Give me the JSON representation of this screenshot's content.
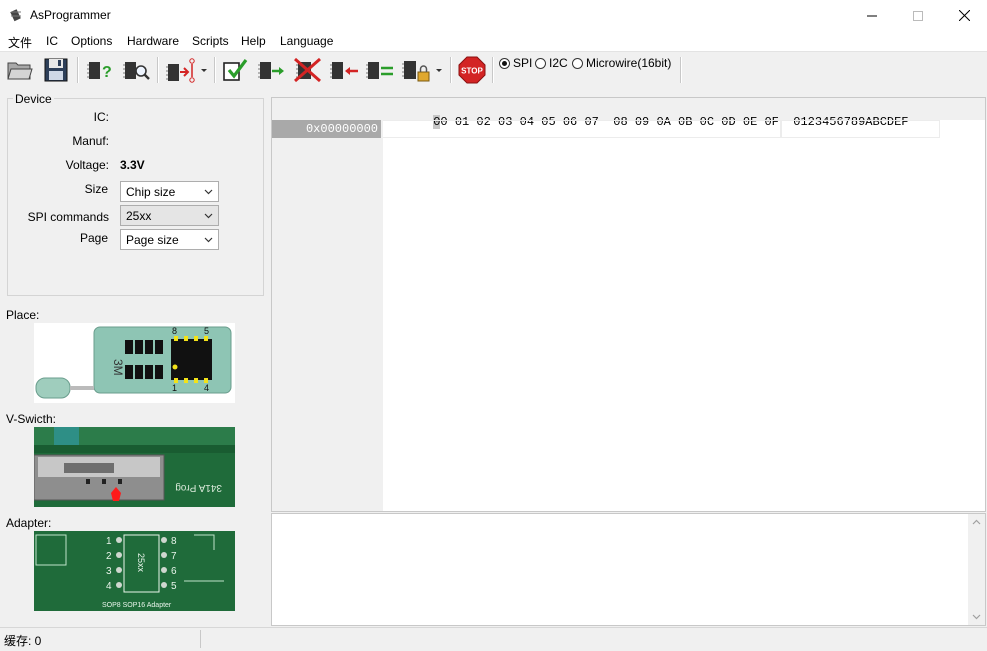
{
  "window": {
    "title": "AsProgrammer"
  },
  "menu": [
    "文件",
    "IC",
    "Options",
    "Hardware",
    "Scripts",
    "Help",
    "Language"
  ],
  "toolbar": {
    "buttons": [
      {
        "name": "open-button",
        "icon": "folder-open-icon"
      },
      {
        "name": "save-button",
        "icon": "floppy-disk-icon"
      },
      {
        "name": "read-id-button",
        "icon": "chip-question-icon"
      },
      {
        "name": "search-chip-button",
        "icon": "chip-magnifier-icon"
      },
      {
        "name": "select-chip-button",
        "icon": "chip-arrow-icon"
      },
      {
        "name": "check-blank-button",
        "icon": "checkmark-icon"
      },
      {
        "name": "read-button",
        "icon": "chip-arrow-right-icon"
      },
      {
        "name": "erase-button",
        "icon": "chip-red-x-icon"
      },
      {
        "name": "write-button",
        "icon": "chip-arrow-left-icon"
      },
      {
        "name": "verify-button",
        "icon": "chip-equals-icon"
      },
      {
        "name": "lock-button",
        "icon": "chip-lock-icon"
      },
      {
        "name": "stop-button",
        "icon": "stop-sign-icon"
      }
    ],
    "stop_label": "STOP",
    "interfaces": [
      {
        "label": "SPI",
        "selected": true
      },
      {
        "label": "I2C",
        "selected": false
      },
      {
        "label": "Microwire(16bit)",
        "selected": false
      }
    ]
  },
  "device": {
    "group_label": "Device",
    "ic_label": "IC:",
    "manuf_label": "Manuf:",
    "voltage_label": "Voltage:",
    "voltage_value": "3.3V",
    "size_label": "Size",
    "size_value": "Chip size",
    "spi_label": "SPI commands",
    "spi_value": "25xx",
    "page_label": "Page",
    "page_value": "Page size"
  },
  "images": {
    "place_label": "Place:",
    "vswitch_label": "V-Swicth:",
    "adapter_label": "Adapter:",
    "place_pin_top_left": "8",
    "place_pin_top_right": "5",
    "place_pin_bottom_left": "1",
    "place_pin_bottom_right": "4",
    "place_brand": "3M",
    "adapter_caption": "SOP8 SOP16 Adapter",
    "adapter_pins_left": [
      "1",
      "2",
      "3",
      "4"
    ],
    "adapter_pins_right": [
      "8",
      "7",
      "6",
      "5"
    ],
    "adapter_chip_label": "25xx",
    "vswitch_text": "341A Prog"
  },
  "hex": {
    "cursor_digit": "0",
    "header_rest": "0 01 02 03 04 05 06 07  08 09 0A 0B 0C 0D 0E 0F  0123456789ABCDEF",
    "address": "0x00000000"
  },
  "status": {
    "text": "缓存: 0"
  },
  "colors": {
    "pcb_green": "#1f6b3a",
    "socket_teal": "#8ec5b4",
    "stop_red": "#d32424",
    "check_green": "#2a9d2a"
  }
}
